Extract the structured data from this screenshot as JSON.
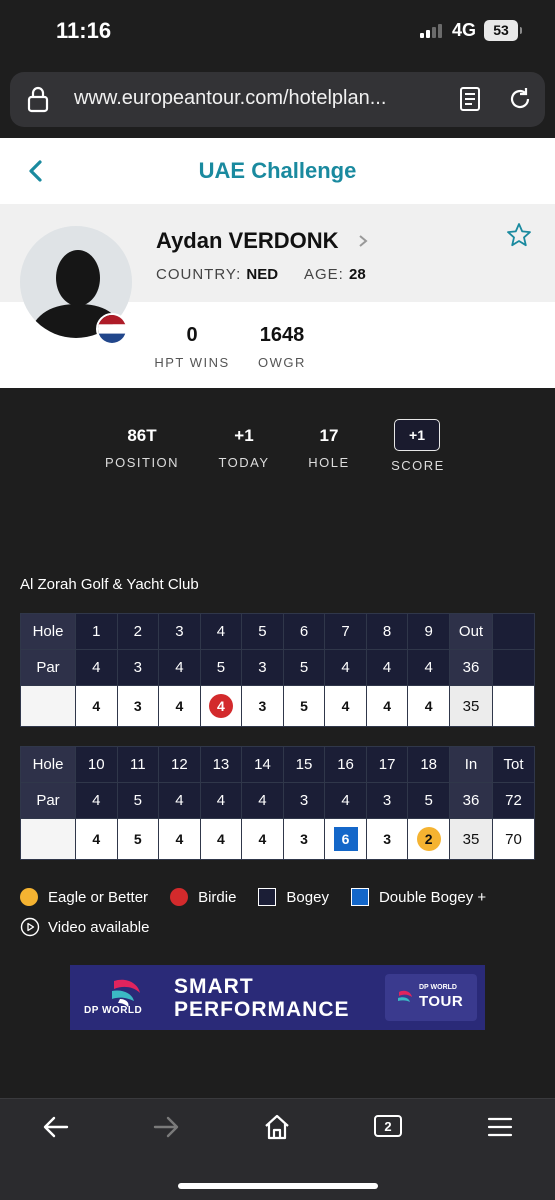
{
  "status_bar": {
    "time": "11:16",
    "network": "4G",
    "battery": "53"
  },
  "browser": {
    "url": "www.europeantour.com/hotelplan..."
  },
  "header": {
    "title": "UAE Challenge"
  },
  "player": {
    "name": "Aydan VERDONK",
    "country_label": "COUNTRY:",
    "country": "NED",
    "age_label": "AGE:",
    "age": "28",
    "hpt_wins": "0",
    "hpt_wins_label": "HPT WINS",
    "owgr": "1648",
    "owgr_label": "OWGR"
  },
  "summary": {
    "position": "86T",
    "position_label": "POSITION",
    "today": "+1",
    "today_label": "TODAY",
    "hole": "17",
    "hole_label": "HOLE",
    "score": "+1",
    "score_label": "SCORE"
  },
  "course": "Al Zorah Golf & Yacht Club",
  "front_nine": {
    "hole_label": "Hole",
    "par_label": "Par",
    "total_label": "Out",
    "holes": [
      "1",
      "2",
      "3",
      "4",
      "5",
      "6",
      "7",
      "8",
      "9"
    ],
    "pars": [
      "4",
      "3",
      "4",
      "5",
      "3",
      "5",
      "4",
      "4",
      "4"
    ],
    "par_total": "36",
    "scores": [
      "4",
      "3",
      "4",
      "4",
      "3",
      "5",
      "4",
      "4",
      "4"
    ],
    "score_total": "35",
    "marks": [
      "",
      "",
      "",
      "birdie",
      "",
      "",
      "",
      "",
      ""
    ]
  },
  "back_nine": {
    "hole_label": "Hole",
    "par_label": "Par",
    "in_label": "In",
    "tot_label": "Tot",
    "holes": [
      "10",
      "11",
      "12",
      "13",
      "14",
      "15",
      "16",
      "17",
      "18"
    ],
    "pars": [
      "4",
      "5",
      "4",
      "4",
      "4",
      "3",
      "4",
      "3",
      "5"
    ],
    "par_in": "36",
    "par_tot": "72",
    "scores": [
      "4",
      "5",
      "4",
      "4",
      "4",
      "3",
      "6",
      "3",
      "2"
    ],
    "score_in": "35",
    "score_tot": "70",
    "marks": [
      "",
      "",
      "",
      "",
      "",
      "",
      "dbogey",
      "",
      "eagle"
    ]
  },
  "legend": {
    "eagle": "Eagle or Better",
    "birdie": "Birdie",
    "bogey": "Bogey",
    "double_bogey": "Double Bogey +",
    "video": "Video available"
  },
  "ad": {
    "line1": "SMART",
    "line2": "PERFORMANCE",
    "brand": "DP WORLD",
    "tour_small": "DP WORLD",
    "tour_big": "TOUR"
  },
  "tabs_count": "2",
  "colors": {
    "accent": "#1a8a9f",
    "birdie": "#d32a2c",
    "eagle": "#f5b331",
    "double_bogey": "#1467c9",
    "bogey": "#1b1e36"
  }
}
